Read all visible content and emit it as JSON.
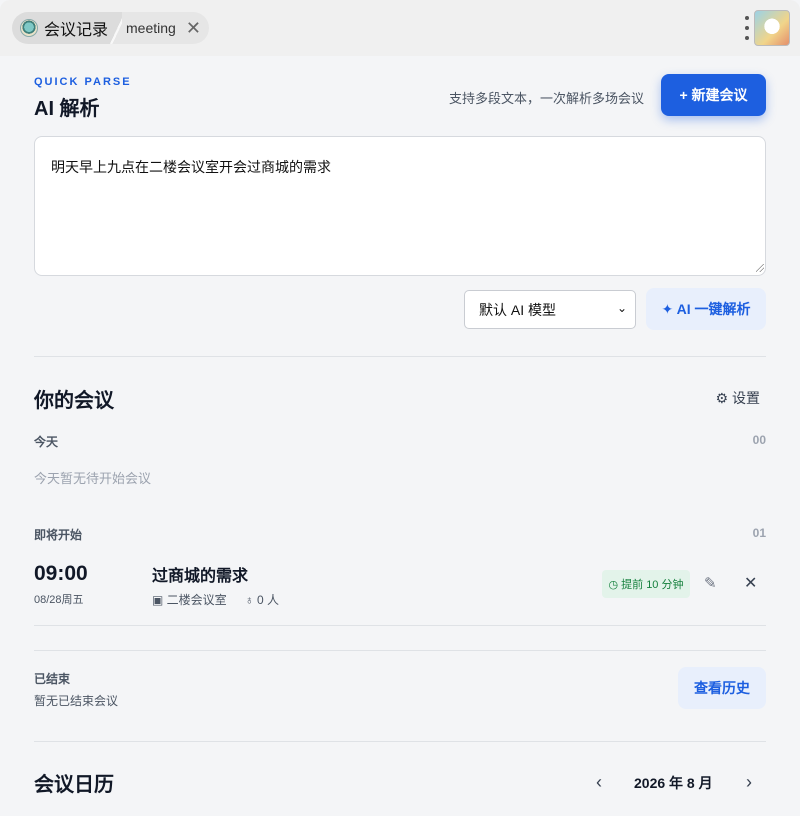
{
  "tabbar": {
    "app_title": "会议记录",
    "page_title": "meeting",
    "close_icon": "close-icon",
    "menu_icon": "kebab-menu-icon"
  },
  "parse": {
    "eyebrow": "QUICK PARSE",
    "title": "AI 解析",
    "hint": "支持多段文本，一次解析多场会议",
    "new_meeting_label": "+ 新建会议",
    "input_value": "明天早上九点在二楼会议室开会过商城的需求",
    "model_selected": "默认 AI 模型",
    "parse_button_label": "✦ AI 一键解析"
  },
  "meetings": {
    "title": "你的会议",
    "settings_label": "⚙ 设置",
    "today": {
      "label": "今天",
      "count": "00",
      "empty": "今天暂无待开始会议"
    },
    "upcoming": {
      "label": "即将开始",
      "count": "01",
      "items": [
        {
          "time": "09:00",
          "date": "08/28周五",
          "title": "过商城的需求",
          "room": "▣ 二楼会议室",
          "people": "♁ 0 人",
          "reminder": "◷ 提前 10 分钟"
        }
      ]
    },
    "ended": {
      "label": "已结束",
      "empty": "暂无已结束会议",
      "history_label": "查看历史"
    }
  },
  "calendar": {
    "title": "会议日历",
    "month": "2026 年 8 月",
    "prev": "‹",
    "next": "›"
  },
  "colors": {
    "accent": "#1d5fe0",
    "accent_soft": "#e8effc",
    "reminder_bg": "#e3f3ea",
    "reminder_fg": "#15803d"
  }
}
